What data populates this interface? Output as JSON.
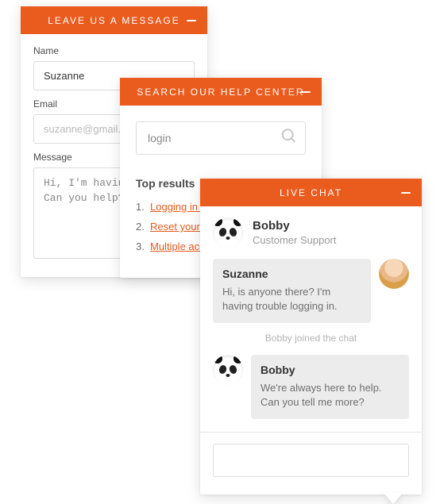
{
  "colors": {
    "accent": "#ea5b1e"
  },
  "leave": {
    "title": "LEAVE US A MESSAGE",
    "name_label": "Name",
    "name_value": "Suzanne",
    "email_label": "Email",
    "email_placeholder": "suzanne@gmail.c",
    "message_label": "Message",
    "message_value": "Hi, I'm having troub\nCan you help?"
  },
  "help": {
    "title": "SEARCH OUR HELP CENTER",
    "search_value": "login",
    "results_title": "Top results",
    "results": [
      "Logging in o",
      "Reset your lo",
      "Multiple acco"
    ]
  },
  "chat": {
    "title": "LIVE CHAT",
    "agent": {
      "name": "Bobby",
      "role": "Customer Support"
    },
    "messages": [
      {
        "who": "Suzanne",
        "text": "Hi, is anyone there? I'm having trouble logging in.",
        "side": "user"
      }
    ],
    "system": "Bobby joined the chat",
    "messages2": [
      {
        "who": "Bobby",
        "text": "We're always here to help. Can you tell me more?",
        "side": "agent"
      }
    ],
    "input_placeholder": ""
  }
}
